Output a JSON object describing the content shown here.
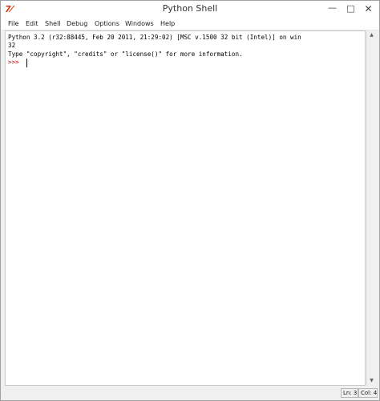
{
  "window": {
    "title": "Python Shell",
    "app_icon": "7⁄",
    "controls": {
      "minimize": "—",
      "maximize": "□",
      "close": "✕"
    }
  },
  "menu": {
    "items": [
      "File",
      "Edit",
      "Shell",
      "Debug",
      "Options",
      "Windows",
      "Help"
    ]
  },
  "editor": {
    "lines": [
      "Python 3.2 (r32:88445, Feb 20 2011, 21:29:02) [MSC v.1500 32 bit (Intel)] on win",
      "32",
      "Type \"copyright\", \"credits\" or \"license()\" for more information."
    ],
    "prompt": ">>> "
  },
  "scrollbar": {
    "up_arrow": "▲",
    "down_arrow": "▼"
  },
  "status": {
    "line": "Ln: 3",
    "column": "Col: 4"
  },
  "colors": {
    "prompt": "#c00000",
    "icon": "#d83a1c"
  }
}
